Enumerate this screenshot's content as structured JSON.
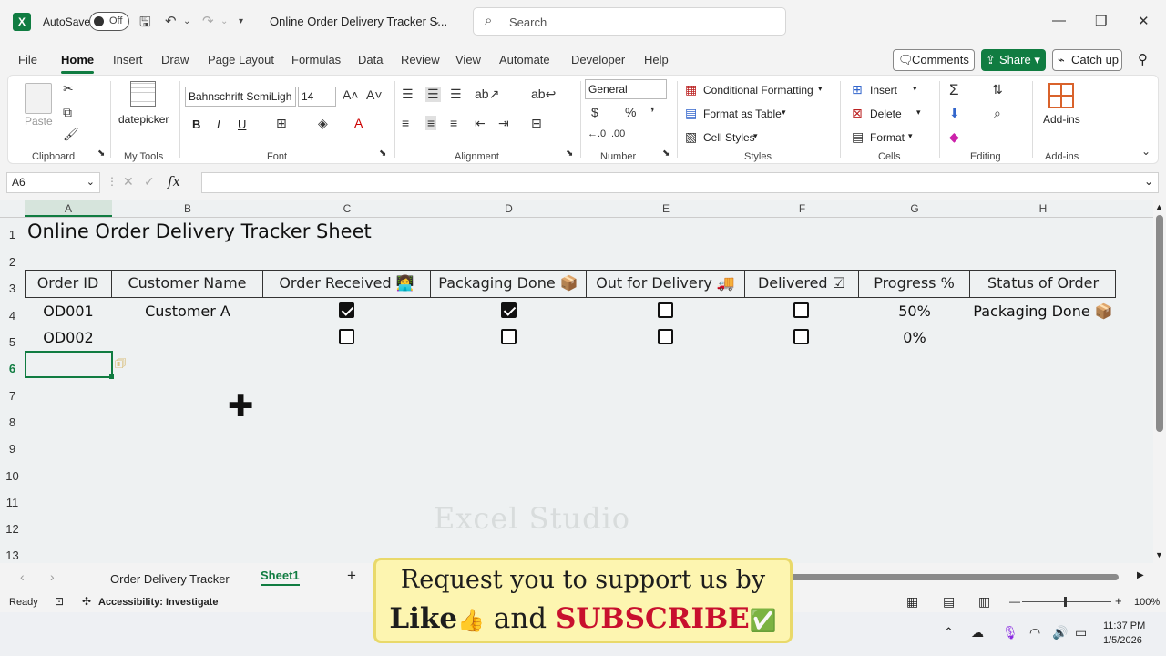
{
  "titlebar": {
    "autosave_label": "AutoSave",
    "autosave_state": "Off",
    "doc_title": "Online Order Delivery Tracker S...",
    "search_placeholder": "Search"
  },
  "menu": [
    "File",
    "Home",
    "Insert",
    "Draw",
    "Page Layout",
    "Formulas",
    "Data",
    "Review",
    "View",
    "Automate",
    "Developer",
    "Help"
  ],
  "actions": {
    "comments": "Comments",
    "share": "Share",
    "catchup": "Catch up"
  },
  "ribbon": {
    "clipboard": {
      "label": "Clipboard",
      "paste": "Paste"
    },
    "mytools": {
      "label": "My Tools",
      "datepicker": "datepicker"
    },
    "font": {
      "label": "Font",
      "name": "Bahnschrift SemiLigh",
      "size": "14",
      "bold": "B",
      "italic": "I",
      "underline": "U"
    },
    "alignment": {
      "label": "Alignment"
    },
    "number": {
      "label": "Number",
      "format": "General"
    },
    "styles": {
      "label": "Styles",
      "conditional": "Conditional Formatting",
      "table": "Format as Table",
      "cell": "Cell Styles"
    },
    "cells": {
      "label": "Cells",
      "insert": "Insert",
      "delete": "Delete",
      "format": "Format"
    },
    "editing": {
      "label": "Editing"
    },
    "addins": {
      "label": "Add-ins",
      "btn": "Add-ins"
    }
  },
  "formula_bar": {
    "name_box": "A6",
    "fx": "fx"
  },
  "columns": [
    "A",
    "B",
    "C",
    "D",
    "E",
    "F",
    "G",
    "H"
  ],
  "rows": [
    "1",
    "2",
    "3",
    "4",
    "5",
    "6",
    "7",
    "8",
    "9",
    "10",
    "11",
    "12",
    "13"
  ],
  "sheet": {
    "title": "Online Order Delivery Tracker Sheet",
    "headers": [
      "Order ID",
      "Customer Name",
      "Order Received 👩‍💻",
      "Packaging Done 📦",
      "Out for Delivery 🚚",
      "Delivered ☑",
      "Progress %",
      "Status of Order"
    ],
    "data": [
      {
        "order_id": "OD001",
        "customer": "Customer A",
        "received": true,
        "packaging": true,
        "out": false,
        "delivered": false,
        "progress": "50%",
        "status": "Packaging Done 📦"
      },
      {
        "order_id": "OD002",
        "customer": "",
        "received": false,
        "packaging": false,
        "out": false,
        "delivered": false,
        "progress": "0%",
        "status": ""
      }
    ],
    "watermark": "Excel Studio"
  },
  "sheet_tabs": [
    "Order Delivery Tracker",
    "Sheet1"
  ],
  "status": {
    "ready": "Ready",
    "accessibility": "Accessibility: Investigate",
    "zoom": "100%"
  },
  "taskbar": {
    "time": "11:37 PM",
    "date": "1/5/2026"
  },
  "promo": {
    "line1": "Request you to support us by",
    "like": "Like",
    "thumb": "👍",
    "and": " and ",
    "subscribe": "SUBSCRIBE",
    "check": "✅"
  }
}
